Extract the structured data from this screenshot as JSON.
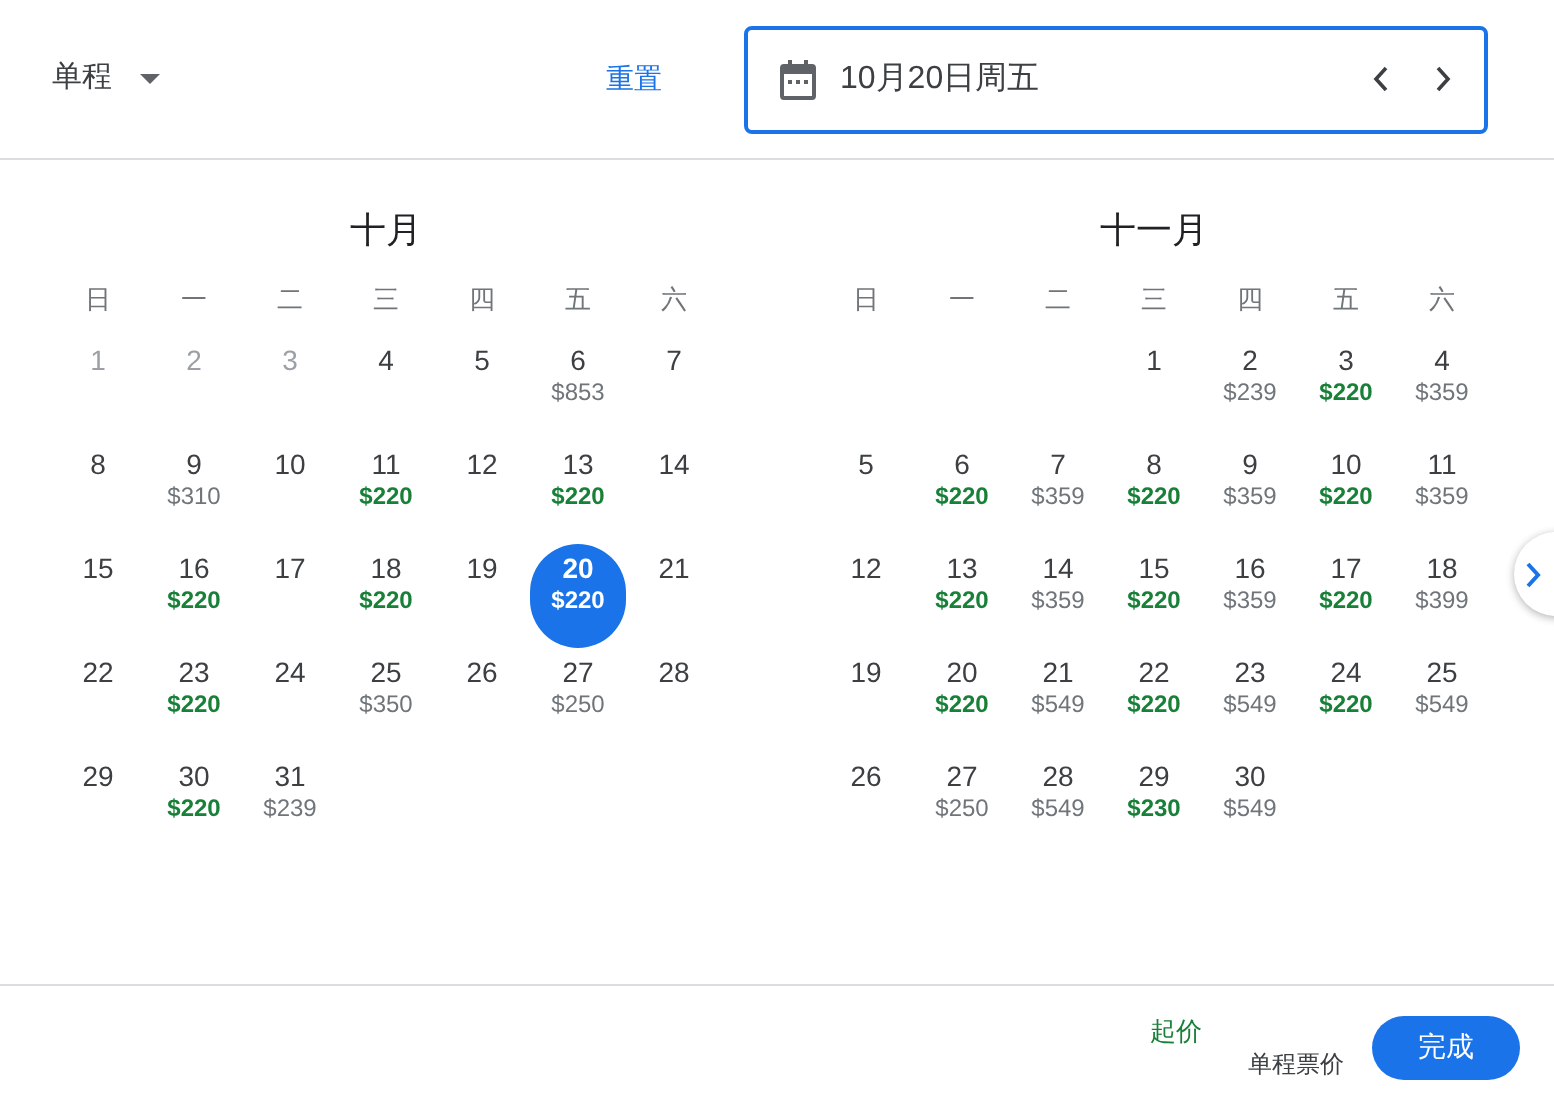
{
  "trip_type": {
    "label": "单程"
  },
  "reset_link": "重置",
  "date_field": {
    "value": "10月20日周五"
  },
  "months": [
    {
      "title": "十月",
      "weekdays": [
        "日",
        "一",
        "二",
        "三",
        "四",
        "五",
        "六"
      ],
      "weeks": [
        {
          "right_aligned": false,
          "days": [
            {
              "day": "1",
              "disabled": true,
              "selected": false
            },
            {
              "day": "2",
              "disabled": true,
              "selected": false
            },
            {
              "day": "3",
              "disabled": true,
              "selected": false
            },
            {
              "day": "4",
              "disabled": false,
              "selected": false
            },
            {
              "day": "5",
              "disabled": false,
              "selected": false
            },
            {
              "day": "6",
              "price": "$853",
              "color": "#70757a",
              "disabled": false,
              "selected": false
            },
            {
              "day": "7",
              "disabled": false,
              "selected": false
            }
          ]
        },
        {
          "days": [
            {
              "day": "8",
              "disabled": false,
              "selected": false
            },
            {
              "day": "9",
              "price": "$310",
              "color": "#70757a",
              "disabled": false,
              "selected": false
            },
            {
              "day": "10",
              "disabled": false,
              "selected": false
            },
            {
              "day": "11",
              "price": "$220",
              "color": "#188038",
              "disabled": false,
              "selected": false
            },
            {
              "day": "12",
              "disabled": false,
              "selected": false
            },
            {
              "day": "13",
              "price": "$220",
              "color": "#188038",
              "disabled": false,
              "selected": false
            },
            {
              "day": "14",
              "disabled": false,
              "selected": false
            }
          ]
        },
        {
          "days": [
            {
              "day": "15",
              "disabled": false,
              "selected": false
            },
            {
              "day": "16",
              "price": "$220",
              "color": "#188038",
              "disabled": false,
              "selected": false
            },
            {
              "day": "17",
              "disabled": false,
              "selected": false
            },
            {
              "day": "18",
              "price": "$220",
              "color": "#188038",
              "disabled": false,
              "selected": false
            },
            {
              "day": "19",
              "disabled": false,
              "selected": false
            },
            {
              "day": "20",
              "price": "$220",
              "disabled": false,
              "selected": true
            },
            {
              "day": "21",
              "disabled": false,
              "selected": false
            }
          ]
        },
        {
          "days": [
            {
              "day": "22",
              "disabled": false,
              "selected": false
            },
            {
              "day": "23",
              "price": "$220",
              "color": "#188038",
              "disabled": false,
              "selected": false
            },
            {
              "day": "24",
              "disabled": false,
              "selected": false
            },
            {
              "day": "25",
              "price": "$350",
              "color": "#70757a",
              "disabled": false,
              "selected": false
            },
            {
              "day": "26",
              "disabled": false,
              "selected": false
            },
            {
              "day": "27",
              "price": "$250",
              "color": "#70757a",
              "disabled": false,
              "selected": false
            },
            {
              "day": "28",
              "disabled": false,
              "selected": false
            }
          ]
        },
        {
          "right_aligned": false,
          "days": [
            {
              "day": "29",
              "disabled": false,
              "selected": false
            },
            {
              "day": "30",
              "price": "$220",
              "color": "#188038",
              "disabled": false,
              "selected": false
            },
            {
              "day": "31",
              "price": "$239",
              "color": "#70757a",
              "disabled": false,
              "selected": false
            }
          ]
        }
      ]
    },
    {
      "title": "十一月",
      "weekdays": [
        "日",
        "一",
        "二",
        "三",
        "四",
        "五",
        "六"
      ],
      "weeks": [
        {
          "right_aligned": true,
          "days": [
            {
              "day": "1",
              "disabled": false,
              "selected": false
            },
            {
              "day": "2",
              "price": "$239",
              "color": "#70757a",
              "disabled": false,
              "selected": false
            },
            {
              "day": "3",
              "price": "$220",
              "color": "#188038",
              "disabled": false,
              "selected": false
            },
            {
              "day": "4",
              "price": "$359",
              "color": "#70757a",
              "disabled": false,
              "selected": false
            }
          ]
        },
        {
          "days": [
            {
              "day": "5",
              "disabled": false,
              "selected": false
            },
            {
              "day": "6",
              "price": "$220",
              "color": "#188038",
              "disabled": false,
              "selected": false
            },
            {
              "day": "7",
              "price": "$359",
              "color": "#70757a",
              "disabled": false,
              "selected": false
            },
            {
              "day": "8",
              "price": "$220",
              "color": "#188038",
              "disabled": false,
              "selected": false
            },
            {
              "day": "9",
              "price": "$359",
              "color": "#70757a",
              "disabled": false,
              "selected": false
            },
            {
              "day": "10",
              "price": "$220",
              "color": "#188038",
              "disabled": false,
              "selected": false
            },
            {
              "day": "11",
              "price": "$359",
              "color": "#70757a",
              "disabled": false,
              "selected": false
            }
          ]
        },
        {
          "days": [
            {
              "day": "12",
              "disabled": false,
              "selected": false
            },
            {
              "day": "13",
              "price": "$220",
              "color": "#188038",
              "disabled": false,
              "selected": false
            },
            {
              "day": "14",
              "price": "$359",
              "color": "#70757a",
              "disabled": false,
              "selected": false
            },
            {
              "day": "15",
              "price": "$220",
              "color": "#188038",
              "disabled": false,
              "selected": false
            },
            {
              "day": "16",
              "price": "$359",
              "color": "#70757a",
              "disabled": false,
              "selected": false
            },
            {
              "day": "17",
              "price": "$220",
              "color": "#188038",
              "disabled": false,
              "selected": false
            },
            {
              "day": "18",
              "price": "$399",
              "color": "#70757a",
              "disabled": false,
              "selected": false
            }
          ]
        },
        {
          "days": [
            {
              "day": "19",
              "disabled": false,
              "selected": false
            },
            {
              "day": "20",
              "price": "$220",
              "color": "#188038",
              "disabled": false,
              "selected": false
            },
            {
              "day": "21",
              "price": "$549",
              "color": "#70757a",
              "disabled": false,
              "selected": false
            },
            {
              "day": "22",
              "price": "$220",
              "color": "#188038",
              "disabled": false,
              "selected": false
            },
            {
              "day": "23",
              "price": "$549",
              "color": "#70757a",
              "disabled": false,
              "selected": false
            },
            {
              "day": "24",
              "price": "$220",
              "color": "#188038",
              "disabled": false,
              "selected": false
            },
            {
              "day": "25",
              "price": "$549",
              "color": "#70757a",
              "disabled": false,
              "selected": false
            }
          ]
        },
        {
          "right_aligned": false,
          "days": [
            {
              "day": "26",
              "disabled": false,
              "selected": false
            },
            {
              "day": "27",
              "price": "$250",
              "color": "#70757a",
              "disabled": false,
              "selected": false
            },
            {
              "day": "28",
              "price": "$549",
              "color": "#70757a",
              "disabled": false,
              "selected": false
            },
            {
              "day": "29",
              "price": "$230",
              "color": "#188038",
              "disabled": false,
              "selected": false
            },
            {
              "day": "30",
              "price": "$549",
              "color": "#70757a",
              "disabled": false,
              "selected": false
            }
          ]
        }
      ]
    }
  ],
  "footer": {
    "price_from": "起价",
    "price_note": "单程票价",
    "done_button": "完成"
  }
}
